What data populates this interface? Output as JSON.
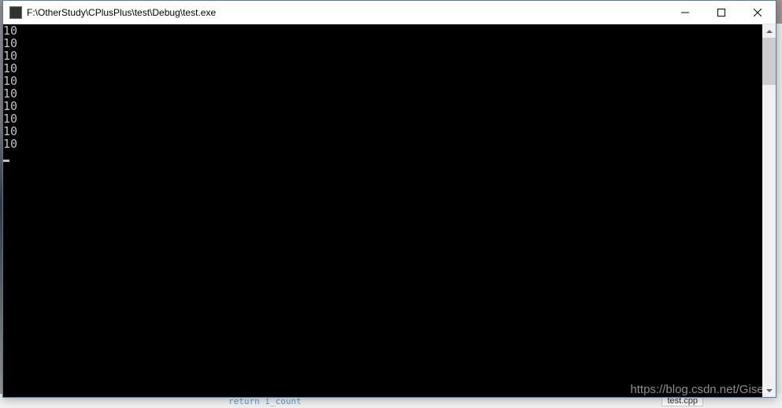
{
  "window": {
    "title": "F:\\OtherStudy\\CPlusPlus\\test\\Debug\\test.exe"
  },
  "console": {
    "lines": [
      "10",
      "10",
      "10",
      "10",
      "10",
      "10",
      "10",
      "10",
      "10",
      "10"
    ]
  },
  "background": {
    "tab_label": "test.cpp",
    "code_snippet": "return i_count"
  },
  "watermark": "https://blog.csdn.net/Giser_"
}
